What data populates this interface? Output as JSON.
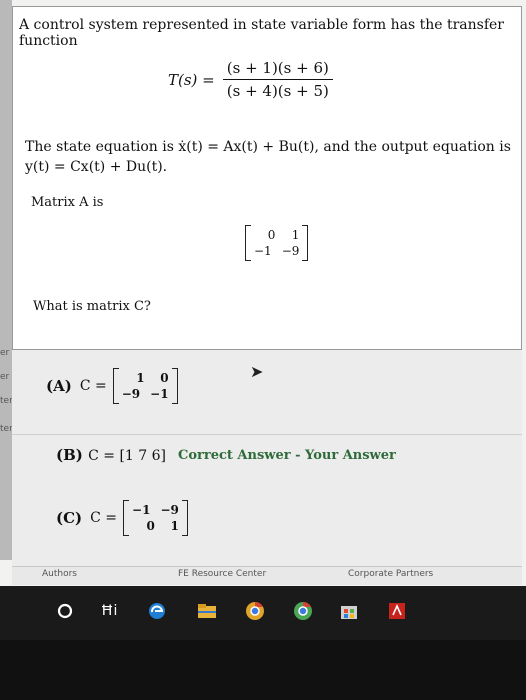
{
  "question": {
    "intro": "A control system represented in state variable form has the transfer function",
    "tf_label": "T(s) =",
    "tf_numerator": "(s + 1)(s + 6)",
    "tf_denominator": "(s + 4)(s + 5)",
    "state_line1": "The state equation is ẋ(t) = Ax(t) + Bu(t), and the output equation is",
    "state_line2": "y(t) = Cx(t) + Du(t).",
    "matrix_a_label": "Matrix A is",
    "matrix_a": [
      [
        "0",
        "1"
      ],
      [
        "−1",
        "−9"
      ]
    ],
    "prompt": "What is matrix C?"
  },
  "options": {
    "a_label": "(A)",
    "a_prefix": "C =",
    "a_matrix": [
      [
        "1",
        "0"
      ],
      [
        "−9",
        "−1"
      ]
    ],
    "b_label": "(B)",
    "b_text": "C = [1 7 6]",
    "b_status": "Correct Answer - Your Answer",
    "c_label": "(C)",
    "c_prefix": "C =",
    "c_matrix": [
      [
        "−1",
        "−9"
      ],
      [
        "0",
        "1"
      ]
    ]
  },
  "side_labels": [
    "er",
    "er",
    "ter",
    "ter"
  ],
  "footer": {
    "authors": "Authors",
    "resource": "FE Resource Center",
    "partners": "Corporate Partners"
  },
  "taskbar": {
    "icons": [
      "search-icon",
      "task-view-icon",
      "edge-icon",
      "file-explorer-icon",
      "chrome-icon",
      "chrome-icon",
      "store-icon",
      "acrobat-icon"
    ],
    "task_view_glyph": "Ħi"
  },
  "colors": {
    "correct": "#2f6b3a",
    "taskbar": "#1a1a1a"
  }
}
